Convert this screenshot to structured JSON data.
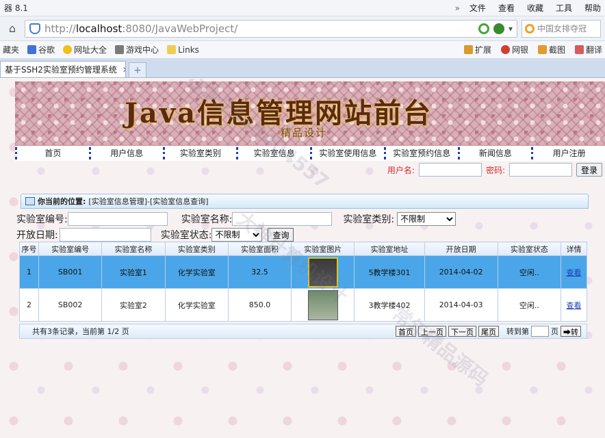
{
  "browser": {
    "brand": "器 8.1",
    "menu": [
      "文件",
      "查看",
      "收藏",
      "工具",
      "帮助"
    ],
    "url_prefix": "http://",
    "url_host": "localhost",
    "url_rest": ":8080/JavaWebProject/",
    "search_placeholder": "中国女排夺冠",
    "favorites": [
      "藏夹",
      "谷歌",
      "网址大全",
      "游戏中心",
      "Links"
    ],
    "fav_right": [
      "扩展",
      "网银",
      "截图",
      "翻译"
    ],
    "tab_title": "基于SSH2实验室预约管理系统",
    "new_tab": "+"
  },
  "site": {
    "banner_title": "Java信息管理网站前台",
    "banner_sub": "精品设计",
    "nav": [
      "首页",
      "用户信息",
      "实验室类别",
      "实验室信息",
      "实验室使用信息",
      "实验室预约信息",
      "新闻信息",
      "用户注册"
    ],
    "login": {
      "user_label": "用户名:",
      "pwd_label": "密码:",
      "button": "登录"
    }
  },
  "panel": {
    "location_label": "你当前的位置:",
    "location_path": "[实验室信息管理]-[实验室信息查询]",
    "filters": {
      "lab_no_label": "实验室编号:",
      "lab_name_label": "实验室名称:",
      "lab_type_label": "实验室类别:",
      "lab_type_value": "不限制",
      "open_date_label": "开放日期:",
      "lab_state_label": "实验室状态:",
      "lab_state_value": "不限制",
      "query_button": "查询"
    },
    "table": {
      "headers": [
        "序号",
        "实验室编号",
        "实验室名称",
        "实验室类别",
        "实验室面积",
        "实验室图片",
        "实验室地址",
        "开放日期",
        "实验室状态",
        "详情"
      ],
      "rows": [
        {
          "no": "1",
          "code": "SB001",
          "name": "实验室1",
          "type": "化学实验室",
          "area": "32.5",
          "address": "5教学楼301",
          "date": "2014-04-02",
          "state": "空闲..",
          "detail": "查看"
        },
        {
          "no": "2",
          "code": "SB002",
          "name": "实验室2",
          "type": "化学实验室",
          "area": "850.0",
          "address": "3教学楼402",
          "date": "2014-04-03",
          "state": "空闲..",
          "detail": "查看"
        }
      ]
    },
    "pager": {
      "info": "共有3条记录，当前第 1/2 页",
      "first": "首页",
      "prev": "上一页",
      "next": "下一页",
      "last": "尾页",
      "goto_label": "转到第",
      "page_unit": "页",
      "go": "➡转"
    }
  },
  "watermarks": [
    "QQ:2545404557",
    "大神计算机设计",
    "常年精品源码"
  ]
}
